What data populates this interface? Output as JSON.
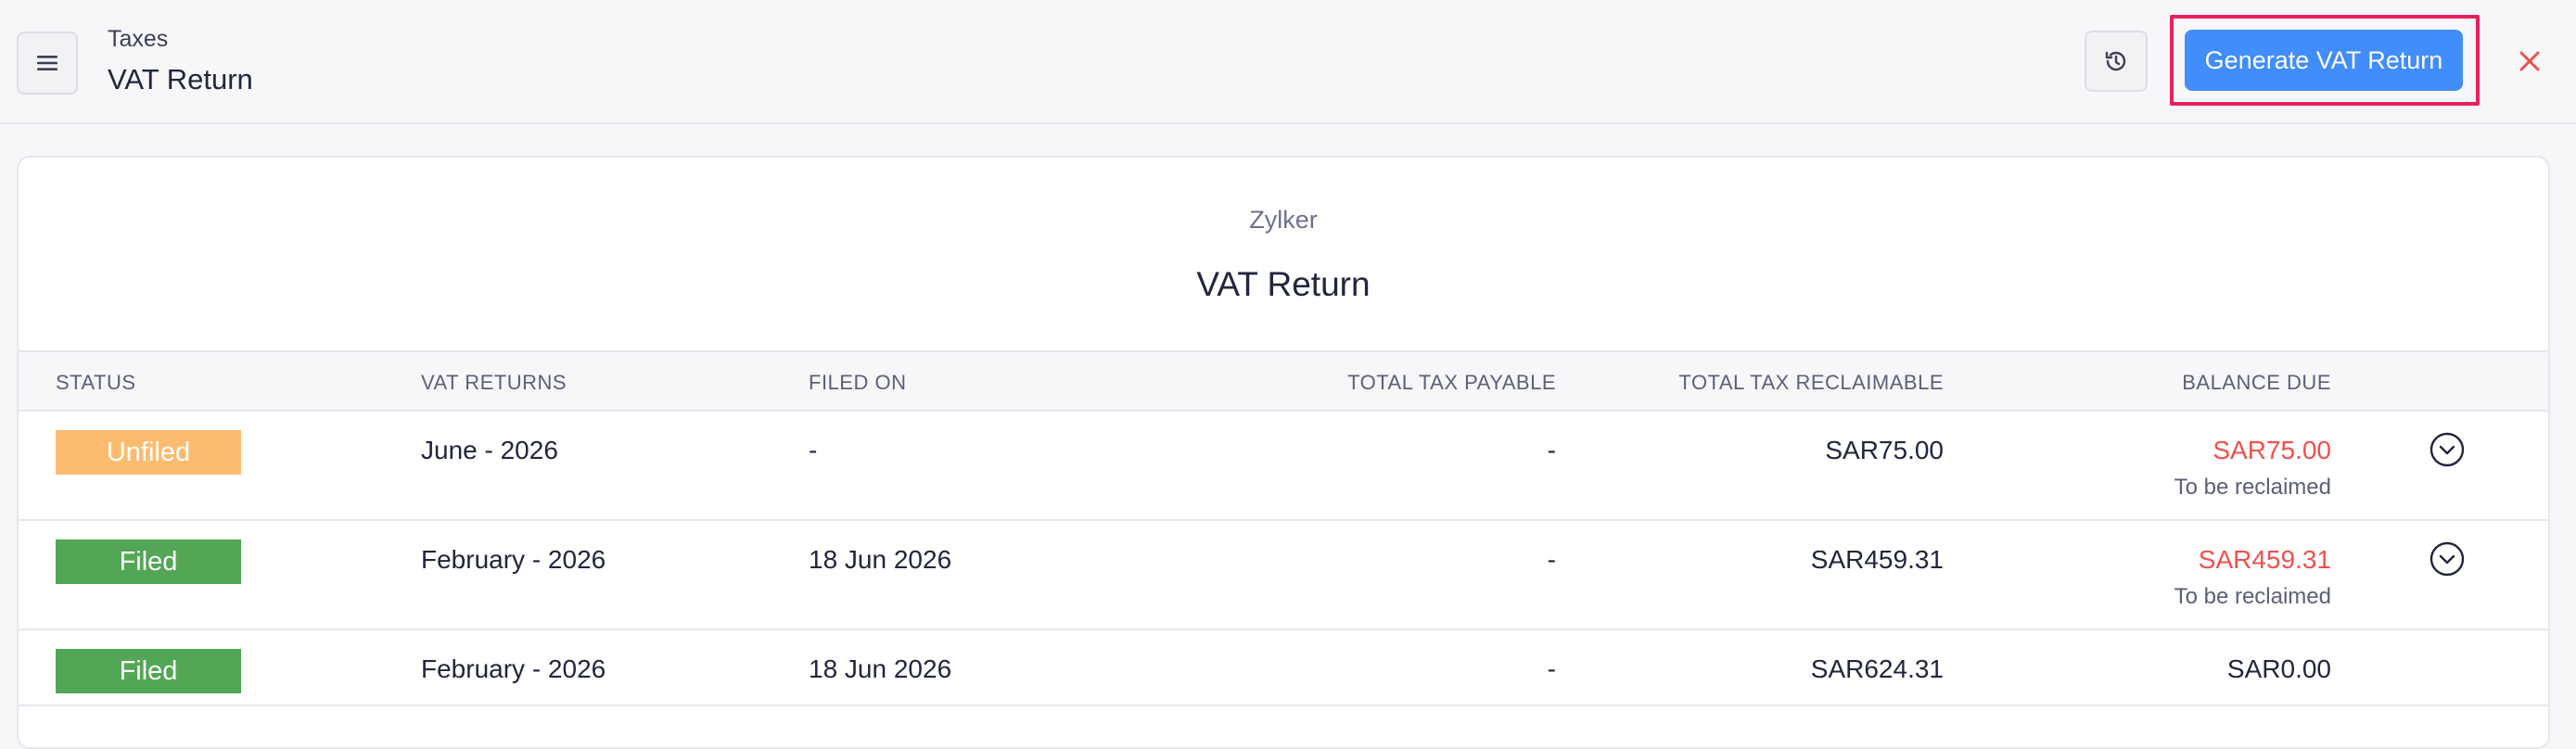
{
  "header": {
    "breadcrumb": "Taxes",
    "title": "VAT Return",
    "generate_label": "Generate VAT Return"
  },
  "report": {
    "org_name": "Zylker",
    "title": "VAT Return"
  },
  "table": {
    "columns": [
      "STATUS",
      "VAT RETURNS",
      "FILED ON",
      "TOTAL TAX PAYABLE",
      "TOTAL TAX RECLAIMABLE",
      "BALANCE DUE"
    ],
    "rows": [
      {
        "status": "Unfiled",
        "status_color": "#fbbc6f",
        "period": "June - 2026",
        "filed_on": "-",
        "tax_payable": "-",
        "tax_reclaimable": "SAR75.00",
        "balance_due": "SAR75.00",
        "balance_note": "To be reclaimed"
      },
      {
        "status": "Filed",
        "status_color": "#53a655",
        "period": "February - 2026",
        "filed_on": "18 Jun 2026",
        "tax_payable": "-",
        "tax_reclaimable": "SAR459.31",
        "balance_due": "SAR459.31",
        "balance_note": "To be reclaimed"
      },
      {
        "status": "Filed",
        "status_color": "#53a655",
        "period": "February - 2026",
        "filed_on": "18 Jun 2026",
        "tax_payable": "-",
        "tax_reclaimable": "SAR624.31",
        "balance_due": "SAR0.00",
        "balance_note": ""
      }
    ]
  },
  "colors": {
    "accent": "#408dfb",
    "highlight": "#e8215d",
    "negative": "#f0504b"
  },
  "icons": [
    "hamburger-menu-icon",
    "history-icon",
    "close-icon",
    "chevron-down-circle-icon"
  ]
}
